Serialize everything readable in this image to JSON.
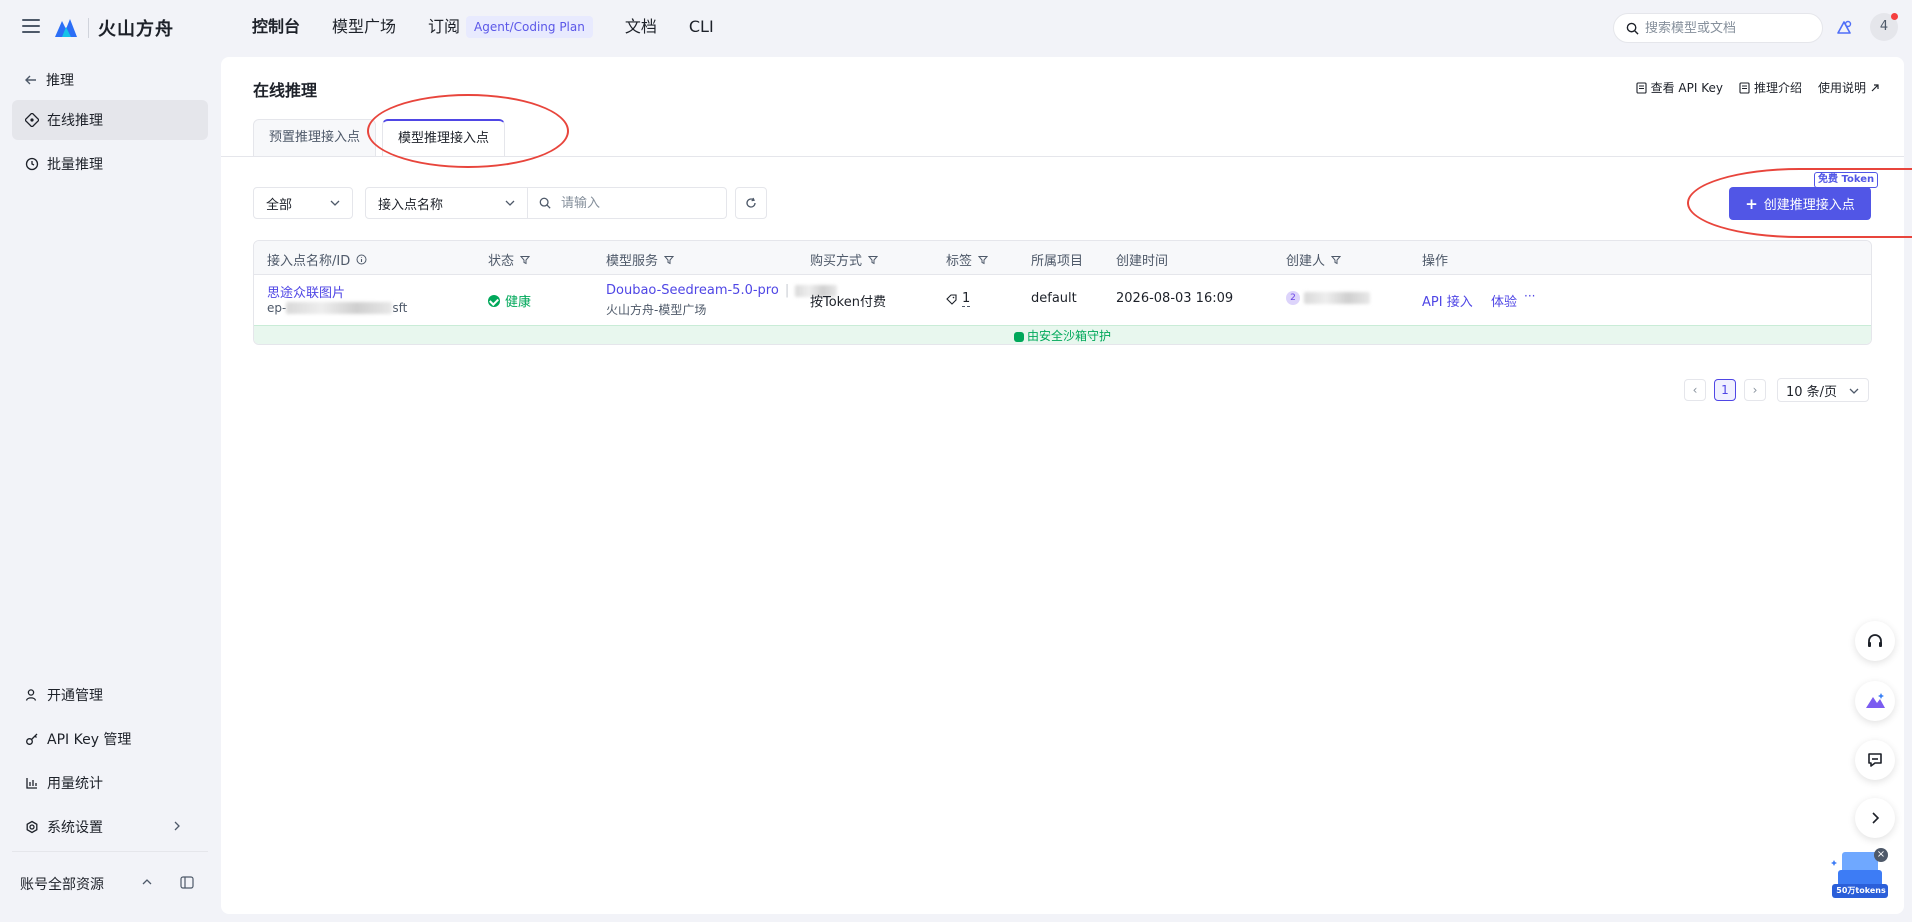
{
  "brand": "火山方舟",
  "nav": [
    {
      "label": "控制台",
      "active": true
    },
    {
      "label": "模型广场"
    },
    {
      "label": "订阅",
      "badge": "Agent/Coding Plan"
    },
    {
      "label": "文档"
    },
    {
      "label": "CLI"
    }
  ],
  "search": {
    "placeholder": "搜索模型或文档"
  },
  "user": {
    "avatar": "4"
  },
  "sidebar": {
    "back": "推理",
    "items": [
      {
        "label": "在线推理"
      },
      {
        "label": "批量推理"
      }
    ],
    "bottom": [
      {
        "label": "开通管理"
      },
      {
        "label": "API Key 管理"
      },
      {
        "label": "用量统计"
      },
      {
        "label": "系统设置"
      }
    ],
    "footer": "账号全部资源"
  },
  "page": {
    "title": "在线推理",
    "links": [
      "查看 API Key",
      "推理介绍",
      "使用说明"
    ],
    "tabs": [
      "预置推理接入点",
      "模型推理接入点"
    ]
  },
  "filters": {
    "scope": "全部",
    "field": "接入点名称",
    "input_placeholder": "请输入"
  },
  "create": {
    "label": "创建推理接入点",
    "tag": "免费 Token"
  },
  "table": {
    "headers": [
      "接入点名称/ID",
      "状态",
      "模型服务",
      "购买方式",
      "标签",
      "所属项目",
      "创建时间",
      "创建人",
      "操作"
    ],
    "row": {
      "name": "思途众联图片",
      "id_prefix": "ep-",
      "id_suffix": "sft",
      "status": "健康",
      "model": "Doubao-Seedream-5.0-pro",
      "model_source": "火山方舟-模型广场",
      "billing": "按Token付费",
      "tags": "1",
      "project": "default",
      "created": "2026-08-03 16:09",
      "creator_avatar": "2",
      "actions": [
        "API 接入",
        "体验",
        "···"
      ]
    },
    "sandbox": "由安全沙箱守护"
  },
  "pagination": {
    "current": "1",
    "size": "10 条/页"
  },
  "promo": "50万tokens"
}
